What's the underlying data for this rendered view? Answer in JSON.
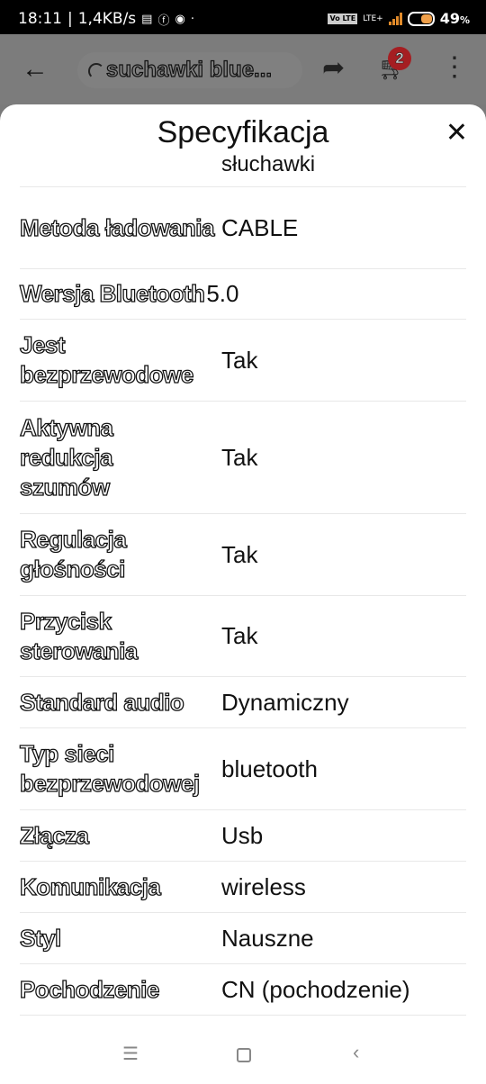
{
  "status_bar": {
    "time": "18:11",
    "speed": "1,4KB/s",
    "network": "LTE+",
    "volte": "Vo LTE",
    "battery_percent": "49",
    "battery_unit": "%",
    "icons": [
      "gallery-icon",
      "facebook-icon",
      "app-icon",
      "dot-icon"
    ]
  },
  "app_bar": {
    "title": "suchawki blue...",
    "cart_count": "2"
  },
  "sheet": {
    "title": "Specyfikacja",
    "partial_row_value": "słuchawki",
    "rows": [
      {
        "label": "Metoda ładowania",
        "value": "CABLE"
      },
      {
        "label": "Wersja Bluetooth",
        "value": "5.0"
      },
      {
        "label": "Jest bezprzewodowe",
        "value": "Tak"
      },
      {
        "label": "Aktywna redukcja szumów",
        "value": "Tak"
      },
      {
        "label": "Regulacja głośności",
        "value": "Tak"
      },
      {
        "label": "Przycisk sterowania",
        "value": "Tak"
      },
      {
        "label": "Standard audio",
        "value": "Dynamiczny"
      },
      {
        "label": "Typ sieci bezprzewodowej",
        "value": "bluetooth"
      },
      {
        "label": "Złącza",
        "value": "Usb"
      },
      {
        "label": "Komunikacja",
        "value": "wireless"
      },
      {
        "label": "Styl",
        "value": "Nauszne"
      },
      {
        "label": "Pochodzenie",
        "value": "CN (pochodzenie)"
      }
    ]
  },
  "colors": {
    "badge": "#a51e22",
    "overlay": "#7c7c7c",
    "battery": "#f0a04a"
  }
}
